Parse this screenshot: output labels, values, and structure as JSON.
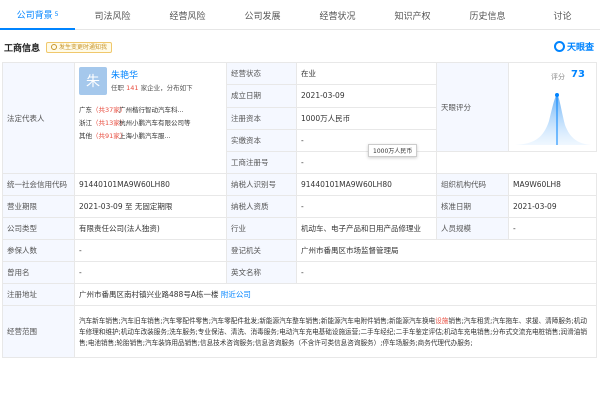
{
  "tabs": [
    {
      "label": "公司背景",
      "count": "5",
      "active": true
    },
    {
      "label": "司法风险"
    },
    {
      "label": "经营风险"
    },
    {
      "label": "公司发展"
    },
    {
      "label": "经营状况"
    },
    {
      "label": "知识产权"
    },
    {
      "label": "历史信息"
    },
    {
      "label": "讨论"
    }
  ],
  "section": {
    "title": "工商信息",
    "notice": "发生变更时通知我",
    "logo_text": "天眼查"
  },
  "legal_rep": {
    "label": "法定代表人",
    "avatar_char": "朱",
    "name": "朱艳华",
    "sub_prefix": "任职",
    "sub_count": "141",
    "sub_suffix": "家企业，分布如下",
    "rows": [
      {
        "prov": "广东",
        "count": "（共37家）",
        "company": "广州楷行智动汽车科..."
      },
      {
        "prov": "浙江",
        "count": "（共13家）",
        "company": "杭州小鹏汽车有限公司等"
      },
      {
        "prov": "其他",
        "count": "（共91家）",
        "company": "上海小鹏汽车服..."
      }
    ]
  },
  "fields": {
    "status_label": "经营状态",
    "status_value": "在业",
    "founded_label": "成立日期",
    "founded_value": "2021-03-09",
    "capital_label": "注册资本",
    "capital_value": "1000万人民币",
    "paid_label": "实缴资本",
    "paid_value": "-",
    "score_label": "天眼评分",
    "regno_label": "工商注册号",
    "regno_value": "-",
    "credit_label": "统一社会信用代码",
    "credit_value": "91440101MA9W60LH80",
    "tax_label": "纳税人识别号",
    "tax_value": "91440101MA9W60LH80",
    "org_label": "组织机构代码",
    "org_value": "MA9W60LH8",
    "term_label": "营业期限",
    "term_value": "2021-03-09 至 无固定期限",
    "taxq_label": "纳税人资质",
    "taxq_value": "-",
    "approve_label": "核准日期",
    "approve_value": "2021-03-09",
    "type_label": "公司类型",
    "type_value": "有限责任公司(法人独资)",
    "industry_label": "行业",
    "industry_value": "机动车、电子产品和日用产品修理业",
    "staff_label": "人员规模",
    "staff_value": "-",
    "insured_label": "参保人数",
    "insured_value": "-",
    "authority_label": "登记机关",
    "authority_value": "广州市番禺区市场监督管理局",
    "former_label": "曾用名",
    "former_value": "-",
    "en_label": "英文名称",
    "en_value": "-",
    "addr_label": "注册地址",
    "addr_value": "广州市番禺区南村镇兴业路488号A栋一楼",
    "addr_link": "附近公司",
    "scope_label": "经营范围",
    "scope_value_1": "汽车新车销售;汽车旧车销售;汽车零配件零售;汽车零配件批发;新能源汽车整车销售;新能源汽车电附件销售;新能源汽车换电",
    "scope_highlight": "设施",
    "scope_value_2": "销售;汽车租赁;汽车拖车、求援、清障服务;机动车修理和维护;机动车改装服务;洗车服务;专业保洁、清洗、消毒服务;电动汽车充电基础设施运营;二手车经纪;二手车鉴定评估;机动车充电销售;分布式交流充电桩销售;润滑油销售;电池销售;轮胎销售;汽车装饰用品销售;信息技术咨询服务;信息咨询服务（不含许可类信息咨询服务）;停车场服务;商务代理代办服务;"
  },
  "score": {
    "label": "评分",
    "value": "73"
  },
  "tooltip": "1000万人民币",
  "colors": {
    "accent": "#0084ff",
    "label_bg": "#f5f8ff",
    "highlight": "#e84e40"
  }
}
